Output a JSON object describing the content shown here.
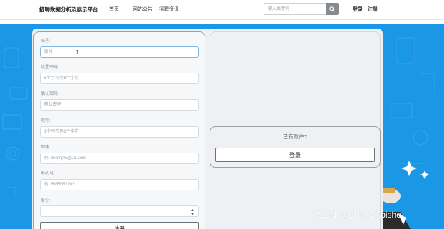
{
  "brand": "招聘数据分析及展示平台",
  "nav": {
    "home": "首页",
    "notice": "网站公告",
    "jobs": "招聘资讯",
    "search_placeholder": "输入关键词",
    "login": "登录",
    "register": "注册"
  },
  "form": {
    "account_label": "账号:",
    "account_placeholder": "账号",
    "password_label": "设置密码:",
    "password_placeholder": "5个字符到8个字符",
    "confirm_label": "确认密码:",
    "confirm_placeholder": "确认密码",
    "nickname_label": "昵称:",
    "nickname_placeholder": "1个字符到8个字符",
    "email_label": "邮箱:",
    "email_placeholder": "例: example@23.com",
    "phone_label": "手机号:",
    "phone_placeholder": "例: 8885552202",
    "identity_label": "身份:",
    "identity_selected": "",
    "submit_label": "注册"
  },
  "side": {
    "have_account": "已有账户?",
    "login_button": "登录"
  },
  "watermark": "CSDN @wxin_VXbishe",
  "colors": {
    "hero_blue": "#1a98e6",
    "search_button": "#888b8d"
  }
}
